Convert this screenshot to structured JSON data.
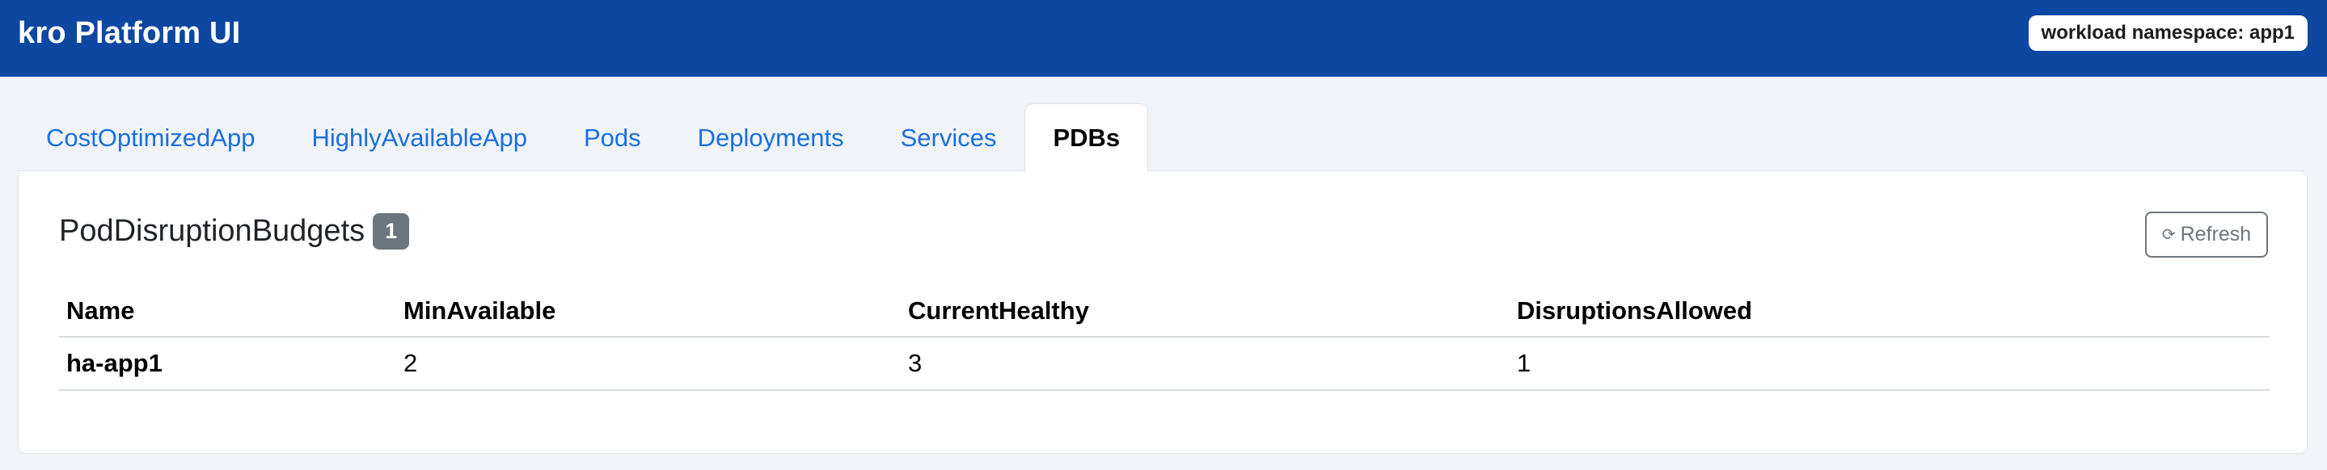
{
  "navbar": {
    "brand": "kro Platform UI",
    "namespace_badge": "workload namespace: app1",
    "color": "#0d47a1"
  },
  "tabs": [
    {
      "label": "CostOptimizedApp",
      "active": false
    },
    {
      "label": "HighlyAvailableApp",
      "active": false
    },
    {
      "label": "Pods",
      "active": false
    },
    {
      "label": "Deployments",
      "active": false
    },
    {
      "label": "Services",
      "active": false
    },
    {
      "label": "PDBs",
      "active": true
    }
  ],
  "panel": {
    "title": "PodDisruptionBudgets",
    "count": "1",
    "refresh_icon": "refresh-icon",
    "refresh_glyph": "⟳",
    "refresh_label": "Refresh"
  },
  "table": {
    "headers": [
      "Name",
      "MinAvailable",
      "CurrentHealthy",
      "DisruptionsAllowed"
    ],
    "rows": [
      [
        "ha-app1",
        "2",
        "3",
        "1"
      ]
    ]
  }
}
